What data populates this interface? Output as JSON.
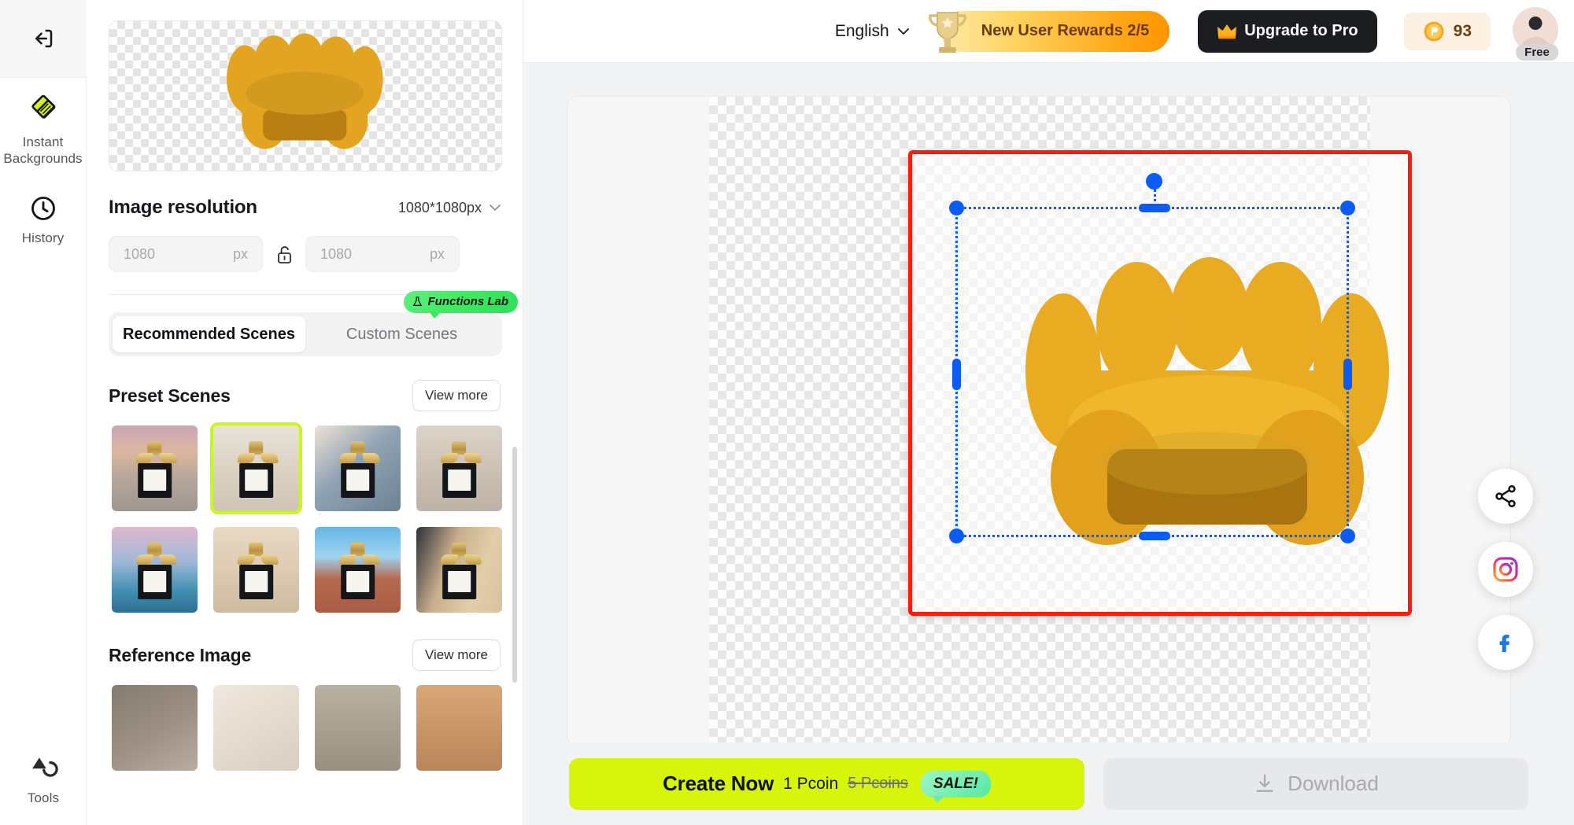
{
  "rail": {
    "collapse_icon": "collapse-panel-icon",
    "items": [
      {
        "id": "instant-backgrounds",
        "icon": "instant-backgrounds-icon",
        "label": "Instant\nBackgrounds",
        "line1": "Instant",
        "line2": "Backgrounds",
        "active": true
      },
      {
        "id": "history",
        "icon": "clock-icon",
        "label": "History",
        "active": false
      }
    ],
    "bottom": {
      "id": "tools",
      "icon": "tools-icon",
      "label": "Tools"
    }
  },
  "panel": {
    "preview_alt": "yellow-armchair-cutout",
    "resolution": {
      "title": "Image resolution",
      "selected": "1080*1080px",
      "chevron": "chevron-down-icon",
      "width_value": "1080",
      "width_placeholder": "1080",
      "height_value": "1080",
      "height_placeholder": "1080",
      "unit": "px",
      "lock_icon": "unlock-icon",
      "locked": false
    },
    "tabs": [
      {
        "id": "recommended-scenes",
        "label": "Recommended Scenes",
        "active": true
      },
      {
        "id": "custom-scenes",
        "label": "Custom Scenes",
        "active": false
      }
    ],
    "functions_lab_badge": {
      "label": "Functions Lab",
      "icon": "flask-icon",
      "color": "#3ce85f"
    },
    "preset_scenes": {
      "title": "Preset Scenes",
      "view_more": "View more",
      "selected_index": 1,
      "items": [
        {
          "name": "highway-sunset",
          "bg": "linear-gradient(180deg,#c9a6b8 0%,#dcb79f 30%,#b9a89c 58%,#9d968f 100%)"
        },
        {
          "name": "gallery-corner",
          "bg": "linear-gradient(180deg,#e8e2d8 0%,#ddd4c6 45%,#cfc5b4 100%)"
        },
        {
          "name": "sunlit-wall",
          "bg": "linear-gradient(140deg,#efe2d4 0%,#8fa3b4 45%,#6d8293 100%)"
        },
        {
          "name": "concrete-pillar",
          "bg": "linear-gradient(180deg,#ddd4c9 0%,#ccc1b4 50%,#bdb2a5 100%)"
        },
        {
          "name": "lake-dusk",
          "bg": "linear-gradient(180deg,#e0b7cf 0%,#9fb9d8 40%,#3f8fb0 75%,#2e6f92 100%)"
        },
        {
          "name": "classic-hall",
          "bg": "linear-gradient(180deg,#e8d9c3 0%,#ddcbb2 50%,#cdbb9f 100%)"
        },
        {
          "name": "mountain-road",
          "bg": "linear-gradient(180deg,#66b6e6 0%,#9fd3ef 35%,#b56a51 60%,#a85c44 100%)"
        },
        {
          "name": "curtain-window",
          "bg": "linear-gradient(110deg,#2d3138 0%,#c8ae8c 38%,#e2cda9 70%,#d8c2a0 100%)"
        }
      ]
    },
    "reference_image": {
      "title": "Reference Image",
      "view_more": "View more",
      "items": [
        {
          "name": "wooden-board-wall",
          "bg": "linear-gradient(150deg,#857b6e 0%,#9d9184 55%,#b9ada0 100%)"
        },
        {
          "name": "sunlight-diagonal",
          "bg": "linear-gradient(150deg,#f0e8de 0%,#e5dbcf 50%,#d9cec0 100%)"
        },
        {
          "name": "branch-blossom",
          "bg": "linear-gradient(180deg,#b9b1a0 0%,#a69c8c 60%,#99907f 100%)"
        },
        {
          "name": "dried-flower",
          "bg": "linear-gradient(180deg,#d9a679 0%,#c89467 55%,#b9855a 100%)"
        }
      ]
    }
  },
  "topbar": {
    "language": {
      "label": "English",
      "chevron": "chevron-down-icon"
    },
    "rewards": {
      "label": "New User Rewards 2/5",
      "icon": "trophy-icon",
      "progress_current": 2,
      "progress_total": 5
    },
    "upgrade": {
      "label": "Upgrade to Pro",
      "icon": "crown-icon"
    },
    "coins": {
      "value": "93",
      "icon": "pcoin-icon"
    },
    "avatar": {
      "name": "user-avatar",
      "badge": "Free"
    }
  },
  "canvas": {
    "subject": "yellow-armchair",
    "crop_frame_color": "#ff1a09",
    "selection_color": "#0b5bf5",
    "handles": [
      "top-left",
      "top-right",
      "bottom-left",
      "bottom-right",
      "top-center",
      "bottom-center",
      "left-center",
      "right-center",
      "rotate"
    ]
  },
  "social": [
    {
      "id": "share",
      "icon": "share-icon"
    },
    {
      "id": "instagram",
      "icon": "instagram-icon"
    },
    {
      "id": "facebook",
      "icon": "facebook-icon"
    }
  ],
  "bottombar": {
    "create": {
      "label": "Create Now",
      "price": "1 Pcoin",
      "old_price": "5 Pcoins",
      "sale_badge": "SALE!",
      "color": "#d6f50b"
    },
    "download": {
      "label": "Download",
      "icon": "download-icon",
      "disabled": true
    }
  }
}
